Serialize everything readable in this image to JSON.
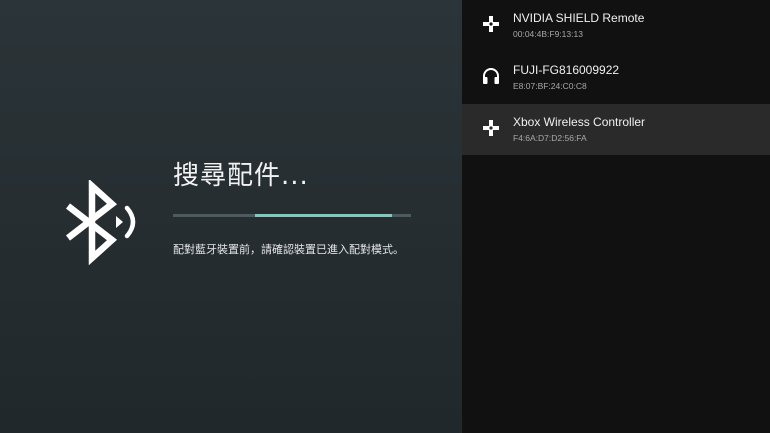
{
  "search": {
    "title": "搜尋配件...",
    "description": "配對藍牙裝置前，請確認裝置已進入配對模式。",
    "progress": 0.58
  },
  "devices": [
    {
      "name": "NVIDIA SHIELD Remote",
      "address": "00:04:4B:F9:13:13",
      "icon": "gamepad-icon"
    },
    {
      "name": "FUJI-FG816009922",
      "address": "E8:07:BF:24:C0:C8",
      "icon": "headset-icon"
    },
    {
      "name": "Xbox Wireless Controller",
      "address": "F4:6A:D7:D2:56:FA",
      "icon": "gamepad-icon",
      "selected": true
    }
  ],
  "colors": {
    "accent": "#7fc9bf",
    "left_bg": "#283135",
    "right_bg": "#111111",
    "selected_row": "#2a2a2a"
  }
}
